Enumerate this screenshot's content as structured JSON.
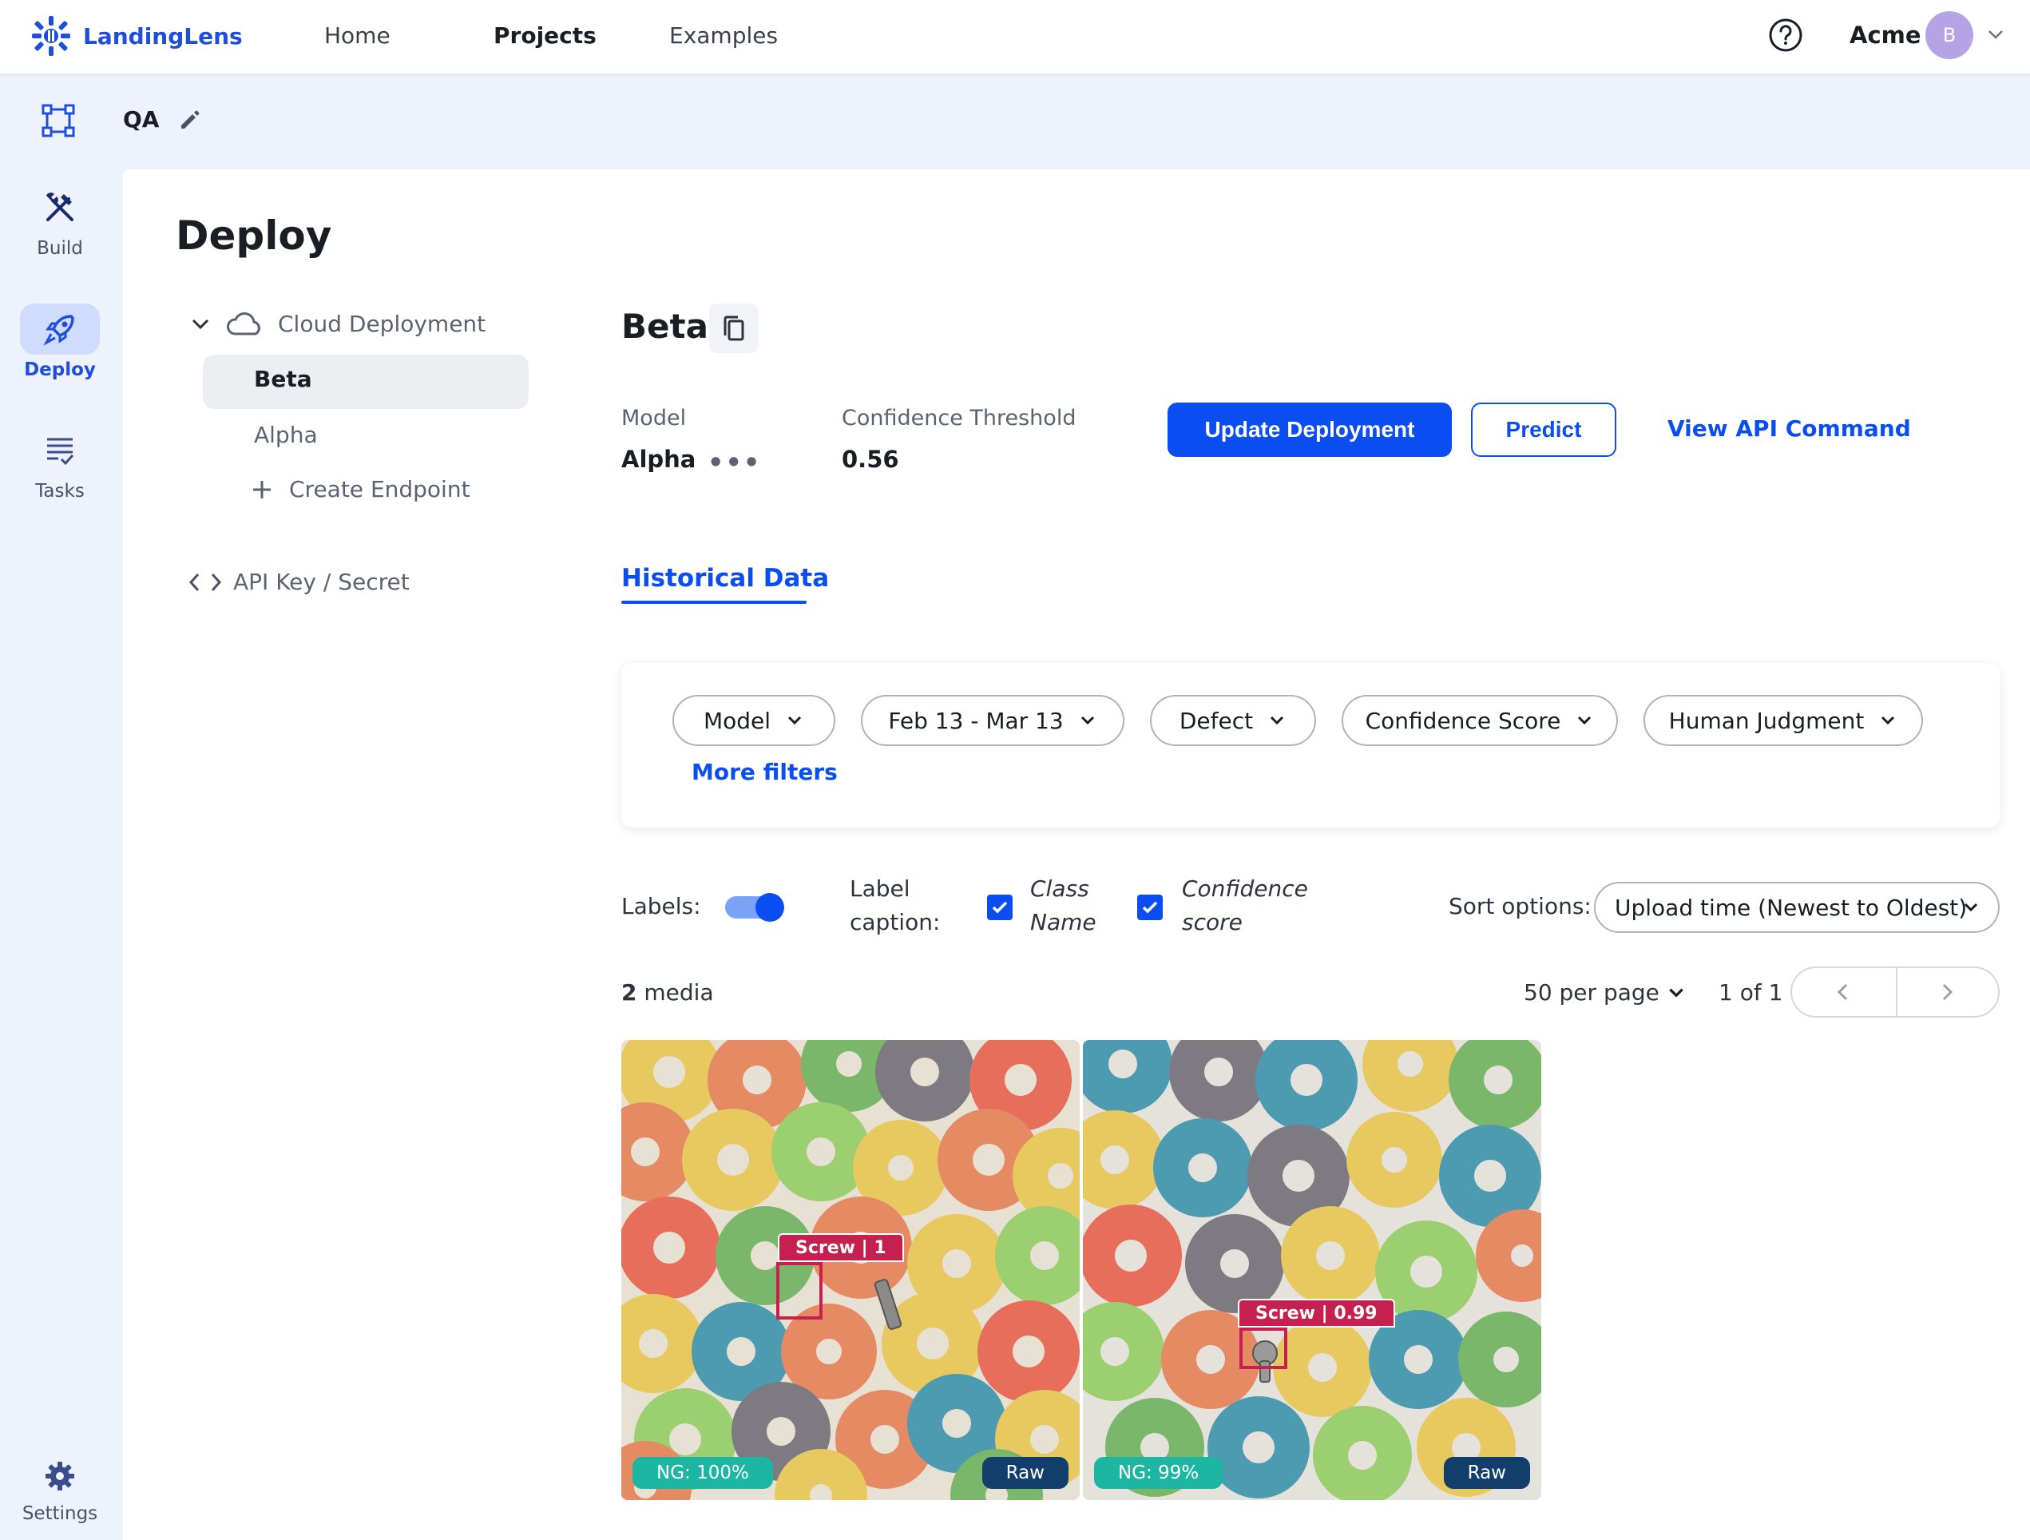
{
  "app": {
    "name": "LandingLens"
  },
  "topnav": {
    "items": [
      "Home",
      "Projects",
      "Examples"
    ],
    "active": "Projects",
    "org": "Acme",
    "avatar_initial": "B"
  },
  "rail": {
    "items": [
      {
        "label": "Build",
        "icon": "build-icon"
      },
      {
        "label": "Deploy",
        "icon": "rocket-icon",
        "active": true
      },
      {
        "label": "Tasks",
        "icon": "tasks-icon"
      }
    ],
    "settings": "Settings"
  },
  "project": {
    "name": "QA"
  },
  "page": {
    "title": "Deploy"
  },
  "tree": {
    "group": "Cloud Deployment",
    "endpoints": [
      "Beta",
      "Alpha"
    ],
    "selected": "Beta",
    "create": "Create Endpoint",
    "api_key": "API Key / Secret"
  },
  "deployment": {
    "name": "Beta",
    "model_label": "Model",
    "model_value": "Alpha",
    "threshold_label": "Confidence Threshold",
    "threshold_value": "0.56",
    "update_button": "Update Deployment",
    "predict_button": "Predict",
    "api_command": "View API Command"
  },
  "tabs": {
    "historical": "Historical Data"
  },
  "filters": {
    "pills": [
      "Model",
      "Feb 13 - Mar 13",
      "Defect",
      "Confidence Score",
      "Human Judgment"
    ],
    "more": "More filters"
  },
  "options": {
    "labels": "Labels:",
    "labels_on": true,
    "caption_line1": "Label",
    "caption_line2": "caption:",
    "class_line1": "Class",
    "class_line2": "Name",
    "class_checked": true,
    "conf_line1": "Confidence",
    "conf_line2": "score",
    "conf_checked": true,
    "sort_label": "Sort options:",
    "sort_value": "Upload time (Newest to Oldest)"
  },
  "media": {
    "count": "2",
    "count_label": "media",
    "per_page": "50 per page",
    "page": "1 of 1",
    "items": [
      {
        "label": "Screw | 1",
        "ng": "NG: 100%",
        "view": "Raw"
      },
      {
        "label": "Screw | 0.99",
        "ng": "NG: 99%",
        "view": "Raw"
      }
    ]
  },
  "colors": {
    "accent": "#0a4ef2",
    "label": "#c5204f",
    "ng": "#1db6a3",
    "raw": "#123e6c"
  }
}
